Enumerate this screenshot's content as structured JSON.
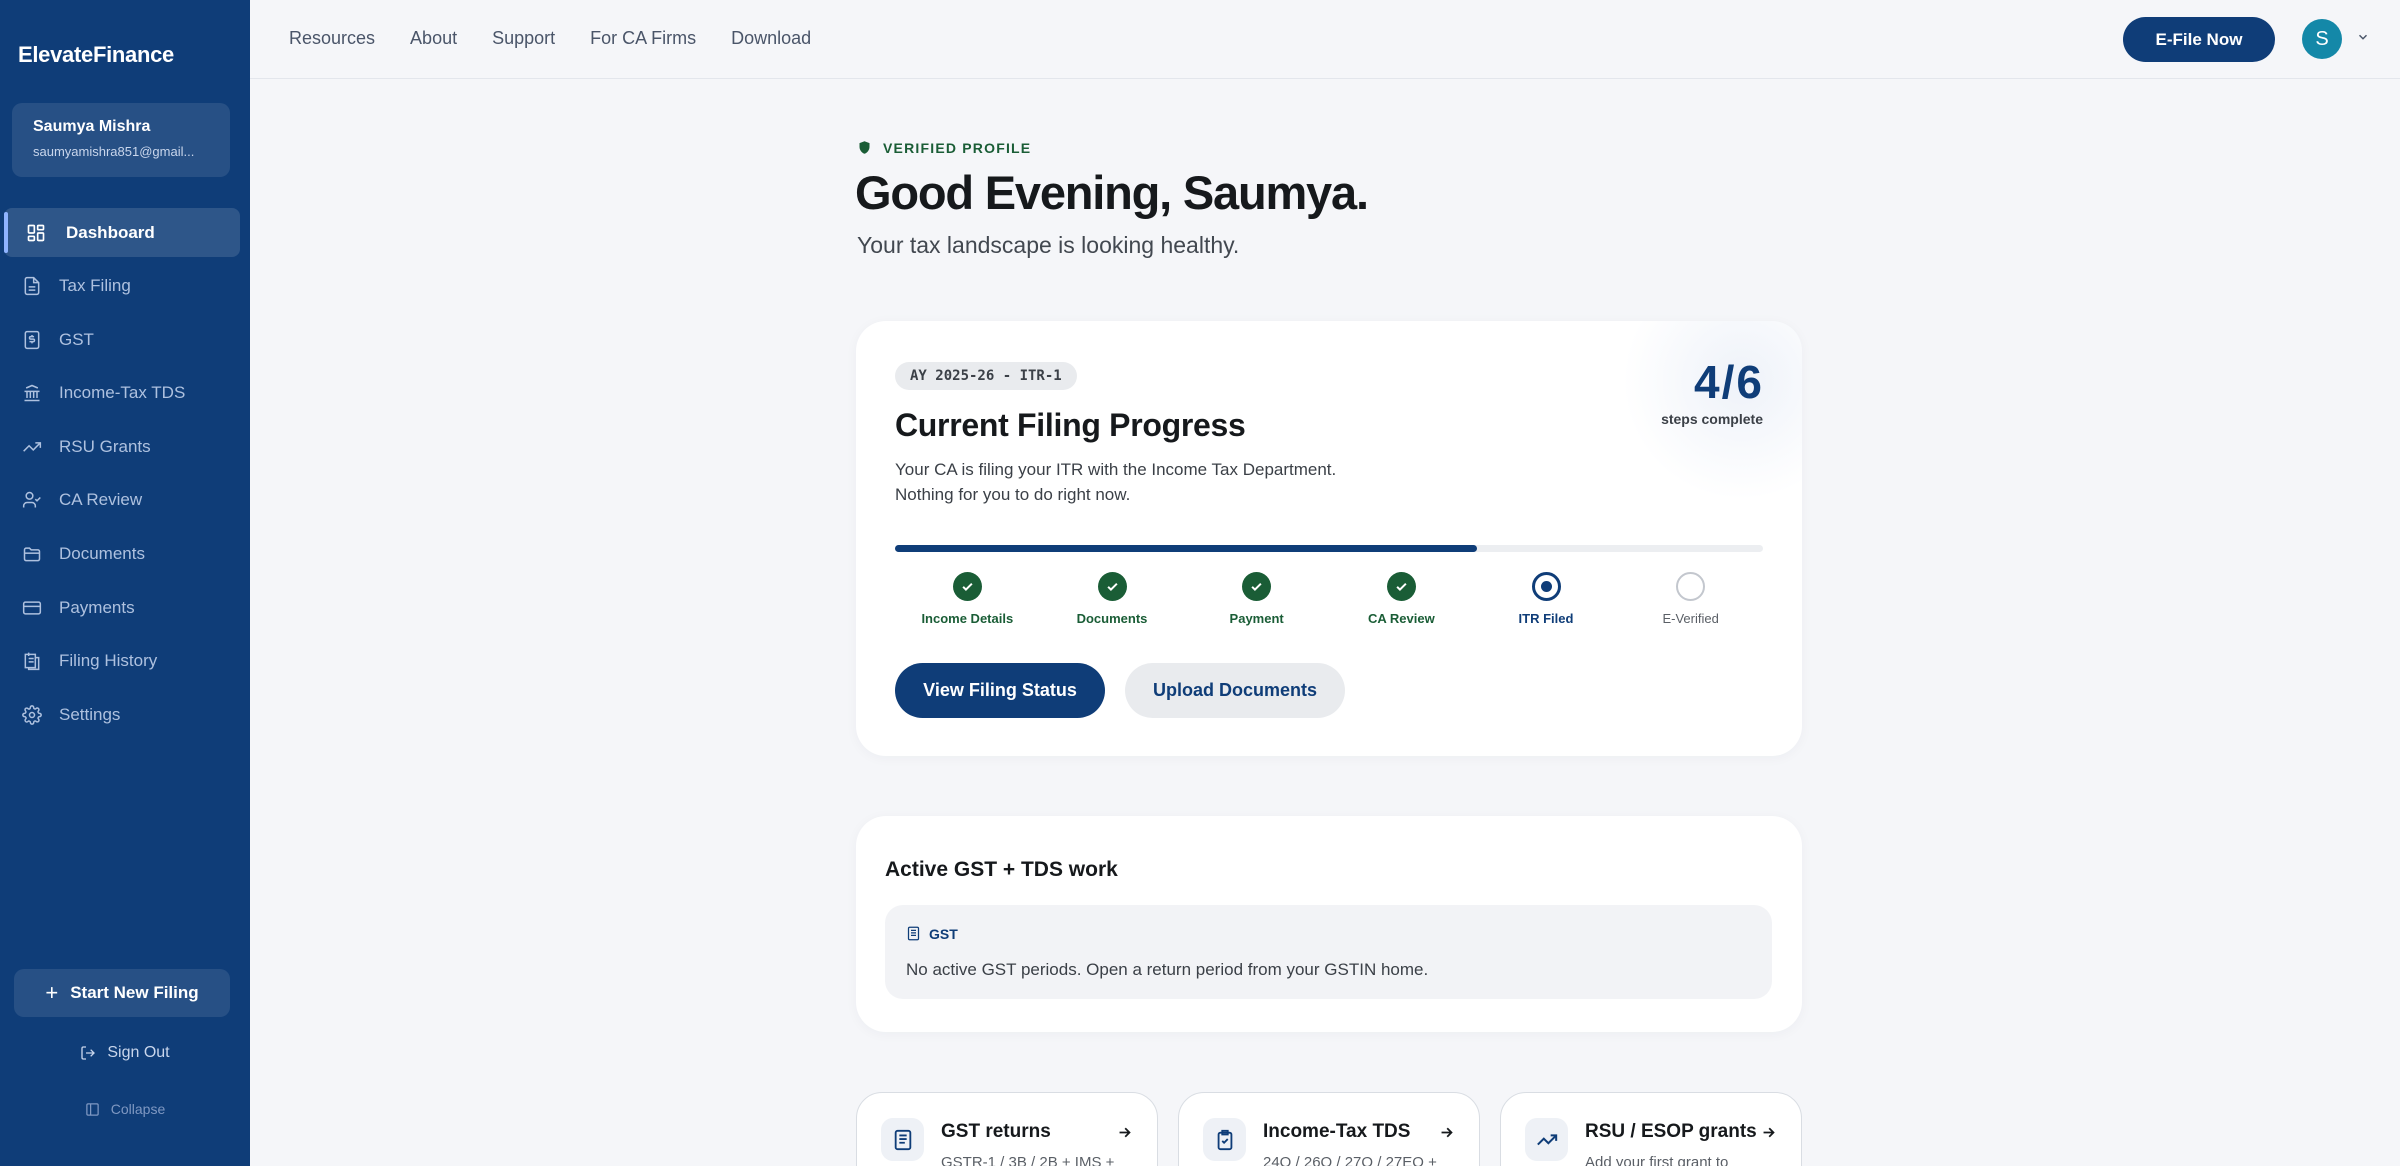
{
  "brand": "ElevateFinance",
  "user": {
    "name": "Saumya Mishra",
    "email": "saumyamishra851@gmail..."
  },
  "sidebar": {
    "items": [
      {
        "label": "Dashboard",
        "icon": "dashboard-icon",
        "active": true
      },
      {
        "label": "Tax Filing",
        "icon": "document-icon"
      },
      {
        "label": "GST",
        "icon": "receipt-icon"
      },
      {
        "label": "Income-Tax TDS",
        "icon": "bank-icon"
      },
      {
        "label": "RSU Grants",
        "icon": "trending-up-icon"
      },
      {
        "label": "CA Review",
        "icon": "user-check-icon"
      },
      {
        "label": "Documents",
        "icon": "folder-icon"
      },
      {
        "label": "Payments",
        "icon": "credit-card-icon"
      },
      {
        "label": "Filing History",
        "icon": "history-icon"
      },
      {
        "label": "Settings",
        "icon": "gear-icon"
      }
    ],
    "start_new": "Start New Filing",
    "sign_out": "Sign Out",
    "collapse": "Collapse"
  },
  "topnav": {
    "links": [
      "Resources",
      "About",
      "Support",
      "For CA Firms",
      "Download"
    ],
    "efile": "E-File Now",
    "avatar_initial": "S"
  },
  "hero": {
    "badge": "VERIFIED PROFILE",
    "greeting": "Good Evening, Saumya.",
    "subtitle": "Your tax landscape is looking healthy."
  },
  "progress": {
    "ay": "AY 2025-26 - ITR-1",
    "title": "Current Filing Progress",
    "desc_line1": "Your CA is filing your ITR with the Income Tax Department.",
    "desc_line2": "Nothing for you to do right now.",
    "steps_count": "4/6",
    "steps_label": "steps complete",
    "bar_fraction": 0.67,
    "steps": [
      {
        "label": "Income Details",
        "state": "done"
      },
      {
        "label": "Documents",
        "state": "done"
      },
      {
        "label": "Payment",
        "state": "done"
      },
      {
        "label": "CA Review",
        "state": "done"
      },
      {
        "label": "ITR Filed",
        "state": "current"
      },
      {
        "label": "E-Verified",
        "state": "pending"
      }
    ],
    "primary_btn": "View Filing Status",
    "secondary_btn": "Upload Documents"
  },
  "gst_work": {
    "title": "Active GST + TDS work",
    "tag": "GST",
    "message": "No active GST periods. Open a return period from your GSTIN home."
  },
  "quick_cards": [
    {
      "title": "GST returns",
      "sub": "GSTR-1 / 3B / 2B + IMS +",
      "icon": "document-icon"
    },
    {
      "title": "Income-Tax TDS",
      "sub": "24Q / 26Q / 27Q / 27EQ +",
      "icon": "clipboard-check-icon"
    },
    {
      "title": "RSU / ESOP grants",
      "sub": "Add your first grant to",
      "icon": "trending-up-icon"
    }
  ],
  "colors": {
    "primary": "#0f3d78",
    "success": "#1a5d36",
    "avatar": "#1488a8"
  }
}
